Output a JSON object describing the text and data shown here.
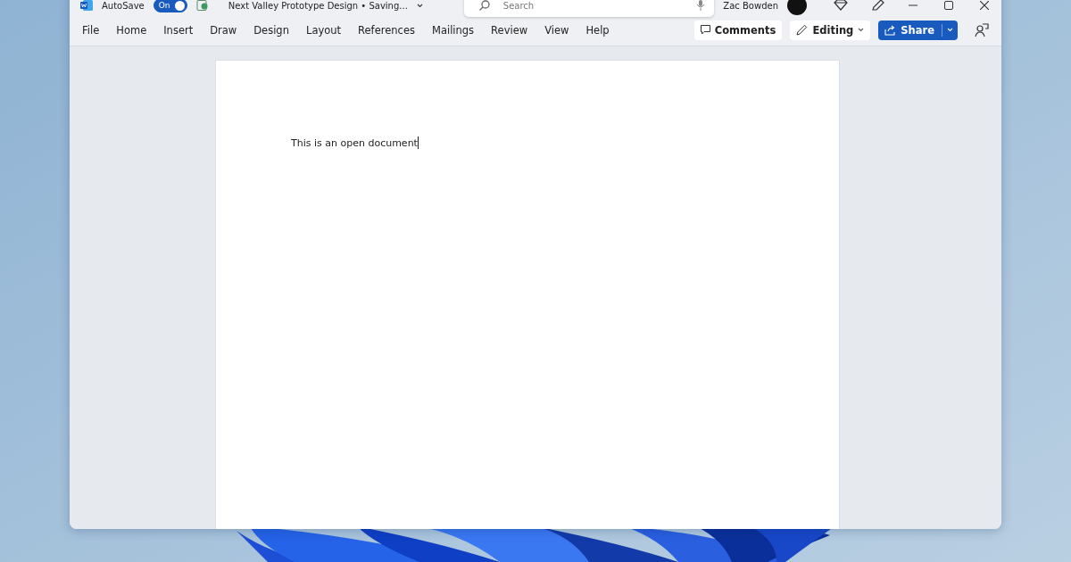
{
  "title_bar": {
    "autosave_label": "AutoSave",
    "autosave_toggle": {
      "label": "On",
      "on": true
    },
    "document_title": "Next Valley Prototype Design • Saving...",
    "search": {
      "placeholder": "Search"
    },
    "user_name": "Zac Bowden"
  },
  "menu_tabs": [
    "File",
    "Home",
    "Insert",
    "Draw",
    "Design",
    "Layout",
    "References",
    "Mailings",
    "Review",
    "View",
    "Help"
  ],
  "actions": {
    "comments": "Comments",
    "editing": "Editing",
    "share": "Share"
  },
  "document": {
    "text": "This is an open document"
  }
}
